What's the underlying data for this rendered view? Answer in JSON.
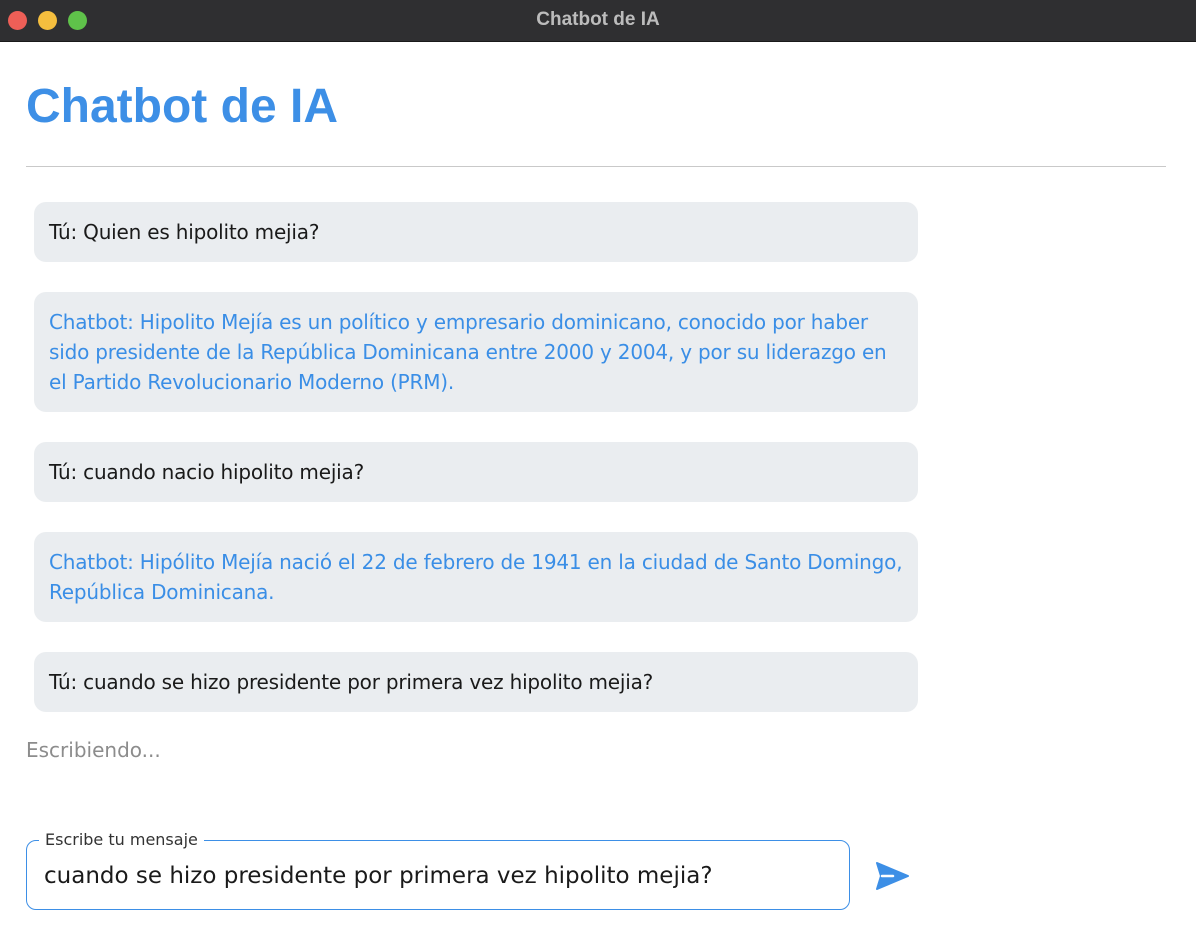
{
  "window": {
    "title": "Chatbot de IA"
  },
  "header": {
    "title": "Chatbot de IA"
  },
  "messages": [
    {
      "role": "user",
      "text": "Tú: Quien es hipolito mejia?"
    },
    {
      "role": "bot",
      "text": "Chatbot: Hipolito Mejía es un político y empresario dominicano, conocido por haber sido presidente de la República Dominicana entre 2000 y 2004, y por su liderazgo en el Partido Revolucionario Moderno (PRM)."
    },
    {
      "role": "user",
      "text": "Tú: cuando nacio hipolito mejia?"
    },
    {
      "role": "bot",
      "text": "Chatbot: Hipólito Mejía nació el 22 de febrero de 1941 en la ciudad de Santo Domingo, República Dominicana."
    },
    {
      "role": "user",
      "text": "Tú: cuando se hizo presidente por primera vez hipolito mejia?"
    }
  ],
  "status": {
    "typing_text": "Escribiendo..."
  },
  "composer": {
    "label": "Escribe tu mensaje",
    "value": "cuando se hizo presidente por primera vez hipolito mejia?",
    "send_icon": "send-icon"
  },
  "colors": {
    "accent": "#3d8fe6",
    "bubble_bg": "#eaedf0",
    "titlebar": "#2f2f31",
    "close": "#ee5f57",
    "minimize": "#f5be3e",
    "zoom": "#5fc24a"
  }
}
